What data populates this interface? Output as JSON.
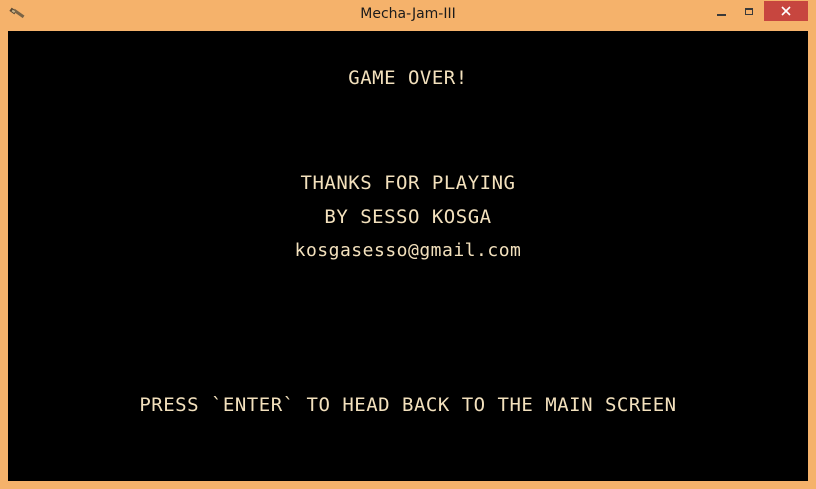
{
  "window": {
    "title": "Mecha-Jam-III",
    "icon": "game-app-icon",
    "controls": {
      "minimize": "minimize-icon",
      "maximize": "maximize-icon",
      "close": "close-icon"
    },
    "frame_color": "#f5b26b",
    "close_color": "#c7463f"
  },
  "screen": {
    "background": "#000000",
    "text_color": "#f3e1bd",
    "heading": "GAME OVER!",
    "thanks": "THANKS FOR PLAYING",
    "byline": "BY SESSO KOSGA",
    "email": "kosgasesso@gmail.com",
    "prompt": "PRESS `ENTER` TO HEAD BACK TO THE MAIN SCREEN"
  }
}
